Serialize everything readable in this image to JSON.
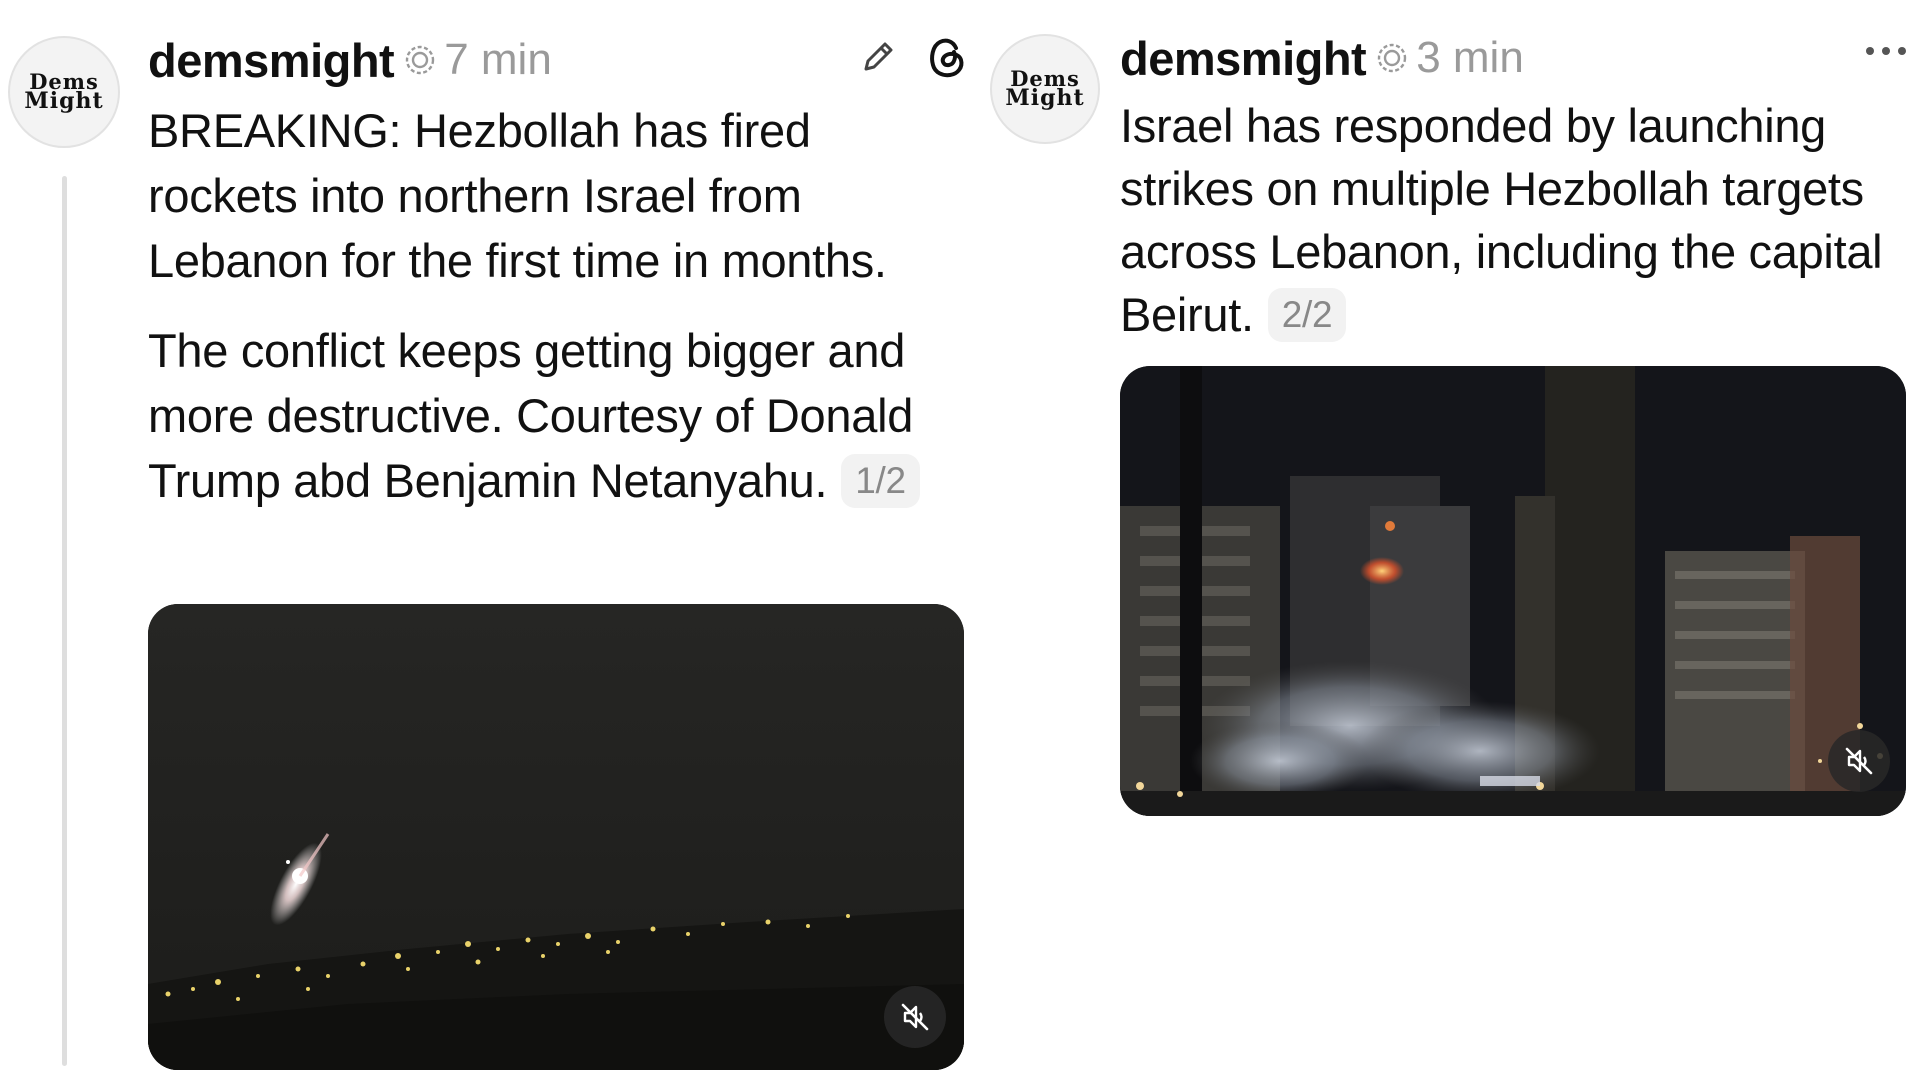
{
  "posts": [
    {
      "avatar_text": [
        "Dems",
        "Might"
      ],
      "username": "demsmight",
      "time": "7 min",
      "paragraphs": [
        "BREAKING: Hezbollah has fired rockets into northern Israel from Lebanon for the first time in months.",
        "The conflict keeps getting bigger and more destructive. Courtesy of Donald Trump abd Benjamin Netanyahu."
      ],
      "thread_position": "1/2",
      "icons": [
        "edit-pencil-icon",
        "threads-logo-icon"
      ],
      "media": {
        "type": "video",
        "muted": true,
        "icon": "speaker-muted-icon"
      }
    },
    {
      "avatar_text": [
        "Dems",
        "Might"
      ],
      "username": "demsmight",
      "time": "3 min",
      "paragraphs": [
        "Israel has responded by launching strikes on multiple Hezbollah targets across Lebanon, including the capital Beirut."
      ],
      "thread_position": "2/2",
      "icons": [
        "more-options-icon"
      ],
      "media": {
        "type": "video",
        "muted": true,
        "icon": "speaker-muted-icon"
      }
    }
  ],
  "colors": {
    "text": "#111111",
    "muted": "#9a9a9a",
    "thread_line": "#dedede",
    "pager_bg": "#f2f2f2"
  }
}
